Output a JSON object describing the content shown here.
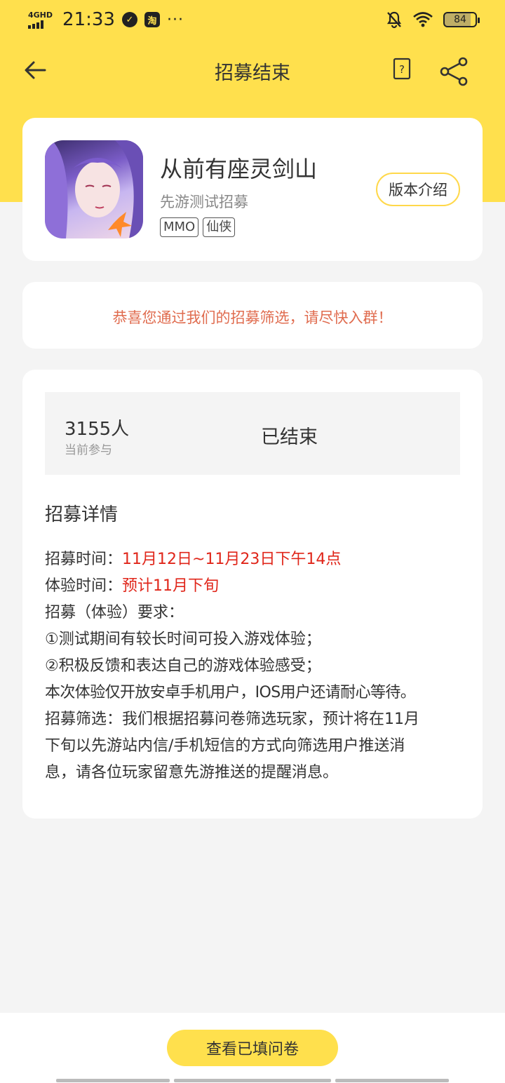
{
  "status": {
    "network": "4GHD",
    "time": "21:33",
    "app_badge_taobao": "淘",
    "app_badge_circle": "✓",
    "more": "···",
    "battery": "84"
  },
  "nav": {
    "title": "招募结束",
    "help_icon": "question-card-icon",
    "share_icon": "share-icon"
  },
  "game": {
    "name": "从前有座灵剑山",
    "subtitle": "先游测试招募",
    "tags": [
      "MMO",
      "仙侠"
    ],
    "version_button": "版本介绍"
  },
  "message": "恭喜您通过我们的招募筛选，请尽快入群！",
  "stats": {
    "count": "3155人",
    "count_label": "当前参与",
    "status": "已结束"
  },
  "details": {
    "title": "招募详情",
    "recruit_time_label": "招募时间：",
    "recruit_time_value": "11月12日~11月23日下午14点",
    "experience_time_label": "体验时间：",
    "experience_time_value": "预计11月下旬",
    "requirements_label": "招募（体验）要求：",
    "req1": "①测试期间有较长时间可投入游戏体验；",
    "req2": "②积极反馈和表达自己的游戏体验感受；",
    "note": "本次体验仅开放安卓手机用户，IOS用户还请耐心等待。",
    "filter_line1": "招募筛选：我们根据招募问卷筛选玩家，预计将在11月",
    "filter_line2": "下旬以先游站内信/手机短信的方式向筛选用户推送消",
    "filter_line3": "息，请各位玩家留意先游推送的提醒消息。"
  },
  "bottom": {
    "button": "查看已填问卷"
  },
  "colors": {
    "accent_yellow": "#ffe04d",
    "message_orange": "#e06c4f",
    "highlight_red": "#e0261a"
  }
}
